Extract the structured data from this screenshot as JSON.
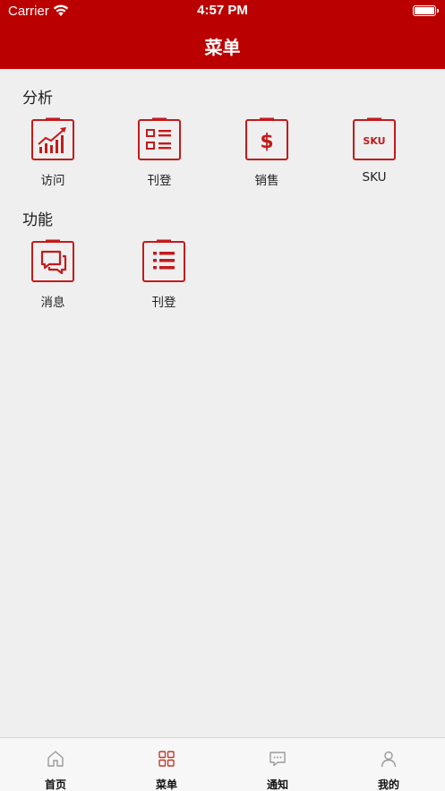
{
  "status_bar": {
    "carrier": "Carrier",
    "time": "4:57 PM"
  },
  "header": {
    "title": "菜单"
  },
  "sections": [
    {
      "title": "分析",
      "items": [
        {
          "label": "访问",
          "icon": "trend-chart-icon"
        },
        {
          "label": "刊登",
          "icon": "checklist-icon"
        },
        {
          "label": "销售",
          "icon": "dollar-icon"
        },
        {
          "label": "SKU",
          "icon": "sku-icon",
          "icon_text": "SKU"
        }
      ]
    },
    {
      "title": "功能",
      "items": [
        {
          "label": "消息",
          "icon": "chat-icon"
        },
        {
          "label": "刊登",
          "icon": "list-icon"
        }
      ]
    }
  ],
  "tabbar": {
    "tabs": [
      {
        "label": "首页",
        "icon": "home-icon"
      },
      {
        "label": "菜单",
        "icon": "grid-icon",
        "active": true
      },
      {
        "label": "通知",
        "icon": "message-icon"
      },
      {
        "label": "我的",
        "icon": "user-icon"
      }
    ]
  },
  "colors": {
    "brand": "#bb0000",
    "icon_red": "#c41a1a",
    "tab_active": "#c0392b",
    "tab_inactive": "#9a9a9a"
  }
}
